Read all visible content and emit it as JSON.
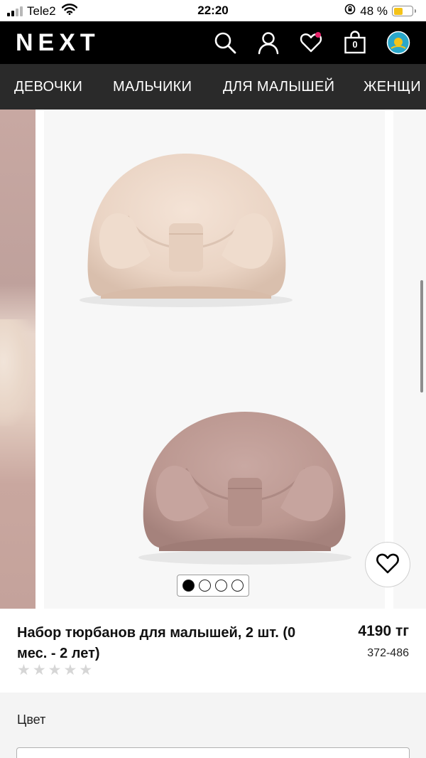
{
  "status_bar": {
    "carrier": "Tele2",
    "time": "22:20",
    "battery_percent": "48 %",
    "battery_level": 0.48
  },
  "header": {
    "logo": "NEXT",
    "bag_count": "0",
    "icons": [
      "search-icon",
      "account-icon",
      "favorites-icon",
      "bag-icon",
      "region-flag-icon"
    ]
  },
  "nav": {
    "items": [
      "ДЕВОЧКИ",
      "МАЛЬЧИКИ",
      "ДЛЯ МАЛЫШЕЙ",
      "ЖЕНЩИ"
    ]
  },
  "gallery": {
    "slide_count": 4,
    "active_index": 0,
    "images": [
      "light-beige-turban-with-bow",
      "dusty-pink-turban-with-bow"
    ]
  },
  "product": {
    "title": "Набор тюрбанов для малышей, 2 шт. (0 мес. - 2 лет)",
    "price": "4190 тг",
    "sku": "372-486",
    "rating": 0,
    "rating_max": 5
  },
  "options": {
    "color_label": "Цвет"
  },
  "colors": {
    "header_bg": "#000000",
    "nav_bg": "#2a2a2a",
    "favorite_dot": "#e7246b",
    "battery": "#f4c318"
  }
}
